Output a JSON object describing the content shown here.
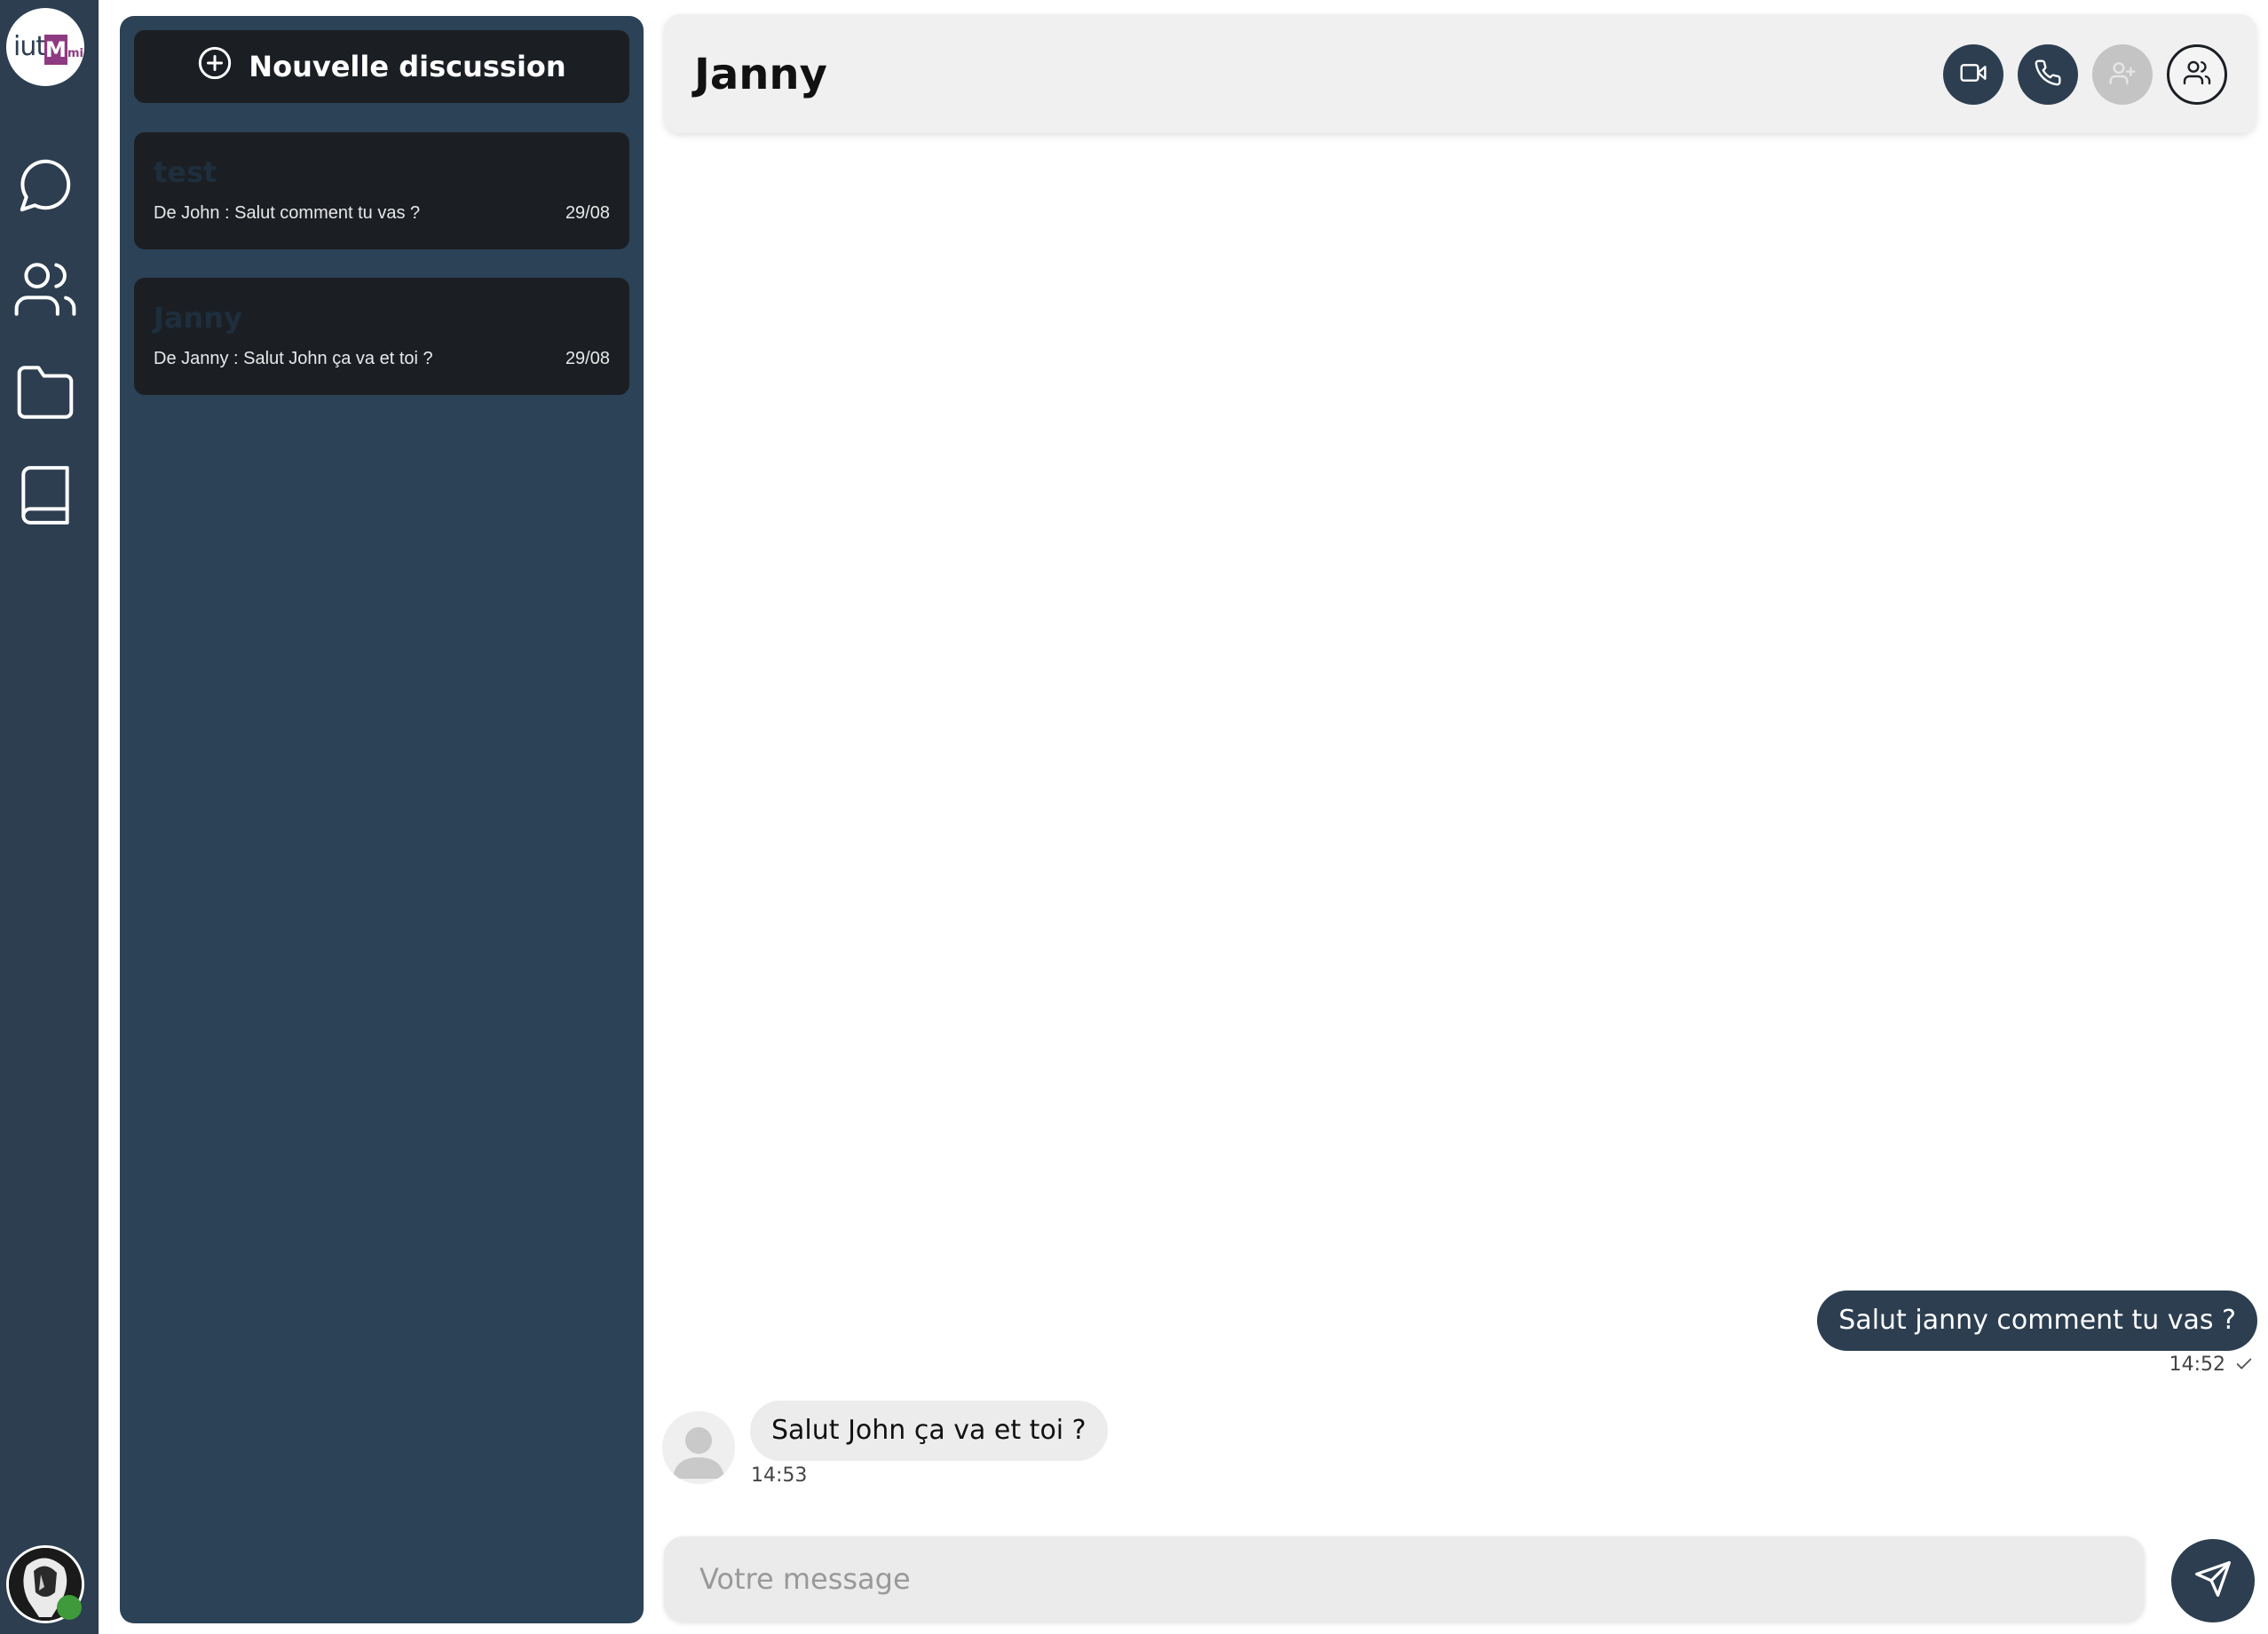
{
  "app": {
    "logo_text": "iut",
    "logo_badge": "M",
    "logo_suffix": "mi"
  },
  "rail": {
    "icons": [
      "chat-bubble-icon",
      "users-icon",
      "folder-icon",
      "book-icon"
    ]
  },
  "sidebar": {
    "new_discussion_label": "Nouvelle discussion",
    "conversations": [
      {
        "name": "test",
        "preview": "De John : Salut comment tu vas ?",
        "date": "29/08"
      },
      {
        "name": "Janny",
        "preview": "De Janny : Salut John ça va et toi ?",
        "date": "29/08"
      }
    ]
  },
  "chat": {
    "title": "Janny",
    "header_buttons": [
      "video-call",
      "voice-call",
      "add-member",
      "members"
    ],
    "messages": [
      {
        "direction": "out",
        "text": "Salut janny comment tu vas ?",
        "time": "14:52",
        "status": "sent"
      },
      {
        "direction": "in",
        "text": "Salut John ça va et toi ?",
        "time": "14:53"
      }
    ]
  },
  "composer": {
    "placeholder": "Votre message",
    "value": ""
  },
  "colors": {
    "rail_bg": "#2c3e50",
    "panel_bg": "#2c4256",
    "item_bg": "#1b1f24",
    "accent": "#2c3e50",
    "presence": "#3e9a3a",
    "logo_accent": "#8e3a82"
  }
}
